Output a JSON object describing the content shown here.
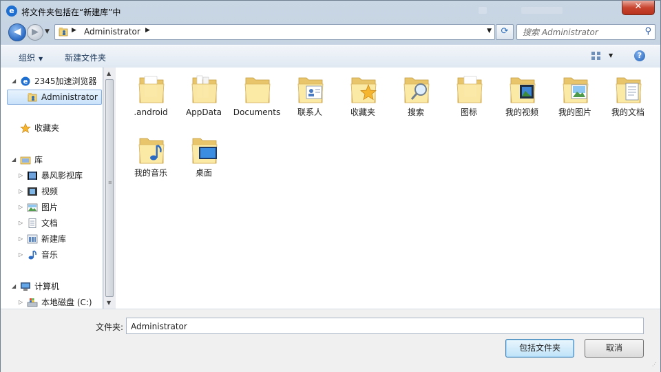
{
  "window": {
    "title": "将文件夹包括在“新建库”中",
    "app_icon_glyph": "e",
    "close_glyph": "✕"
  },
  "nav": {
    "back_glyph": "◀",
    "forward_glyph": "▶",
    "address_path": "Administrator",
    "search_placeholder": "搜索 Administrator"
  },
  "toolbar": {
    "organize_label": "组织",
    "new_folder_label": "新建文件夹",
    "help_glyph": "?"
  },
  "navpane": {
    "items": [
      {
        "label": "2345加速浏览器",
        "icon": "browser-icon"
      },
      {
        "label": "Administrator",
        "icon": "user-folder-icon",
        "selected": true
      },
      {
        "label": "收藏夹",
        "icon": "star-icon"
      },
      {
        "label": "库",
        "icon": "library-icon"
      },
      {
        "label": "暴风影视库",
        "icon": "video-library-icon"
      },
      {
        "label": "视频",
        "icon": "video-icon"
      },
      {
        "label": "图片",
        "icon": "picture-icon"
      },
      {
        "label": "文档",
        "icon": "document-icon"
      },
      {
        "label": "新建库",
        "icon": "library-icon"
      },
      {
        "label": "音乐",
        "icon": "music-icon"
      },
      {
        "label": "计算机",
        "icon": "computer-icon"
      },
      {
        "label": "本地磁盘 (C:)",
        "icon": "drive-icon"
      }
    ]
  },
  "folders": [
    {
      "label": ".android",
      "overlay": "none"
    },
    {
      "label": "AppData",
      "overlay": "none"
    },
    {
      "label": "Documents",
      "overlay": "none"
    },
    {
      "label": "联系人",
      "overlay": "contacts"
    },
    {
      "label": "收藏夹",
      "overlay": "star"
    },
    {
      "label": "搜索",
      "overlay": "search"
    },
    {
      "label": "图标",
      "overlay": "none"
    },
    {
      "label": "我的视频",
      "overlay": "video"
    },
    {
      "label": "我的图片",
      "overlay": "picture"
    },
    {
      "label": "我的文档",
      "overlay": "document"
    },
    {
      "label": "我的音乐",
      "overlay": "music"
    },
    {
      "label": "桌面",
      "overlay": "desktop"
    }
  ],
  "bottom": {
    "folder_label": "文件夹:",
    "folder_value": "Administrator",
    "include_button": "包括文件夹",
    "cancel_button": "取消"
  },
  "colors": {
    "folder_light": "#fbe9a6",
    "folder_dark": "#e8c56a",
    "accent": "#2a6bb8"
  }
}
